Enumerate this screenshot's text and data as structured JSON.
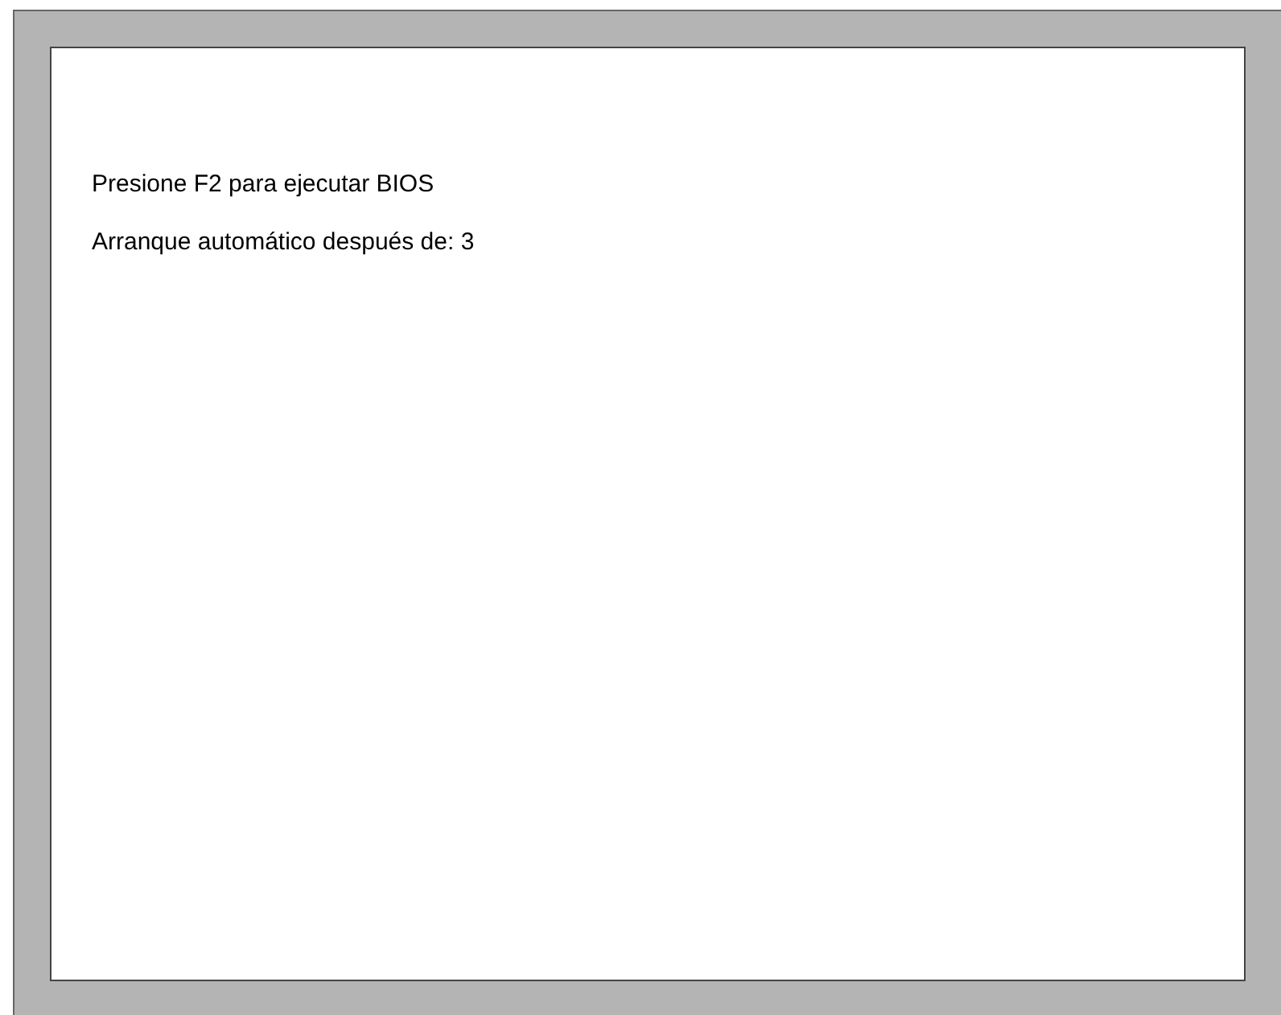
{
  "screen": {
    "lines": [
      "Presione F2 para ejecutar BIOS",
      "Arranque automático después de: 3"
    ]
  }
}
